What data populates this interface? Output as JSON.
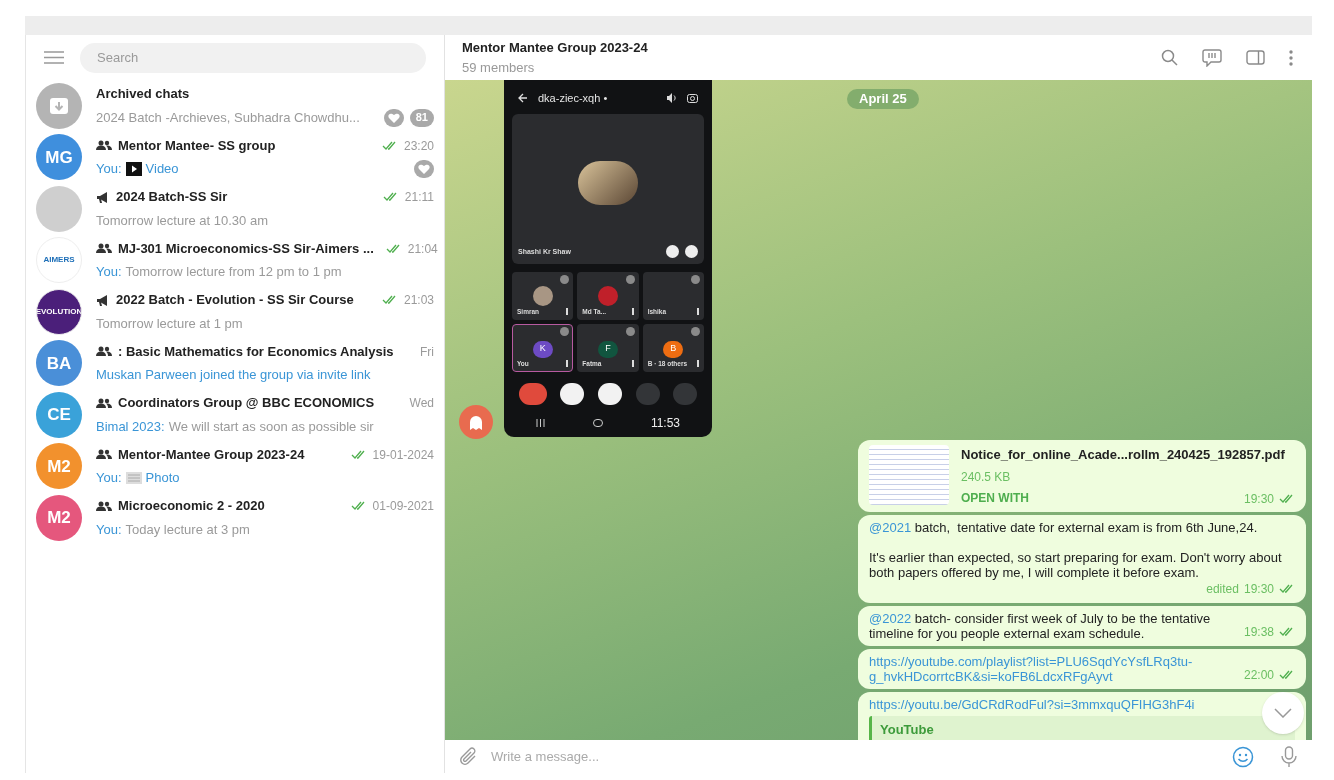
{
  "sidebar": {
    "search": {
      "placeholder": "Search"
    },
    "chats": [
      {
        "kind": "archive",
        "title": "Archived chats",
        "avatar": {
          "kind": "archive",
          "color": "#b4b4b4"
        },
        "preview": {
          "kind": "message",
          "text": "2024 Batch -Archieves, Subhadra Chowdhu..."
        },
        "heart": true,
        "unread": "81",
        "read": false
      },
      {
        "kind": "group",
        "title": "Mentor Mantee- SS group",
        "avatar": {
          "kind": "initials",
          "text": "MG",
          "color": "#3f8fdd"
        },
        "time": "23:20",
        "read": true,
        "preview": {
          "sender": "You:",
          "kind": "video",
          "text": "Video"
        },
        "heart": true
      },
      {
        "kind": "channel",
        "title": "2024 Batch-SS Sir",
        "avatar": {
          "kind": "image",
          "color": "#cfcfcf"
        },
        "time": "21:11",
        "read": true,
        "preview": {
          "kind": "message",
          "text": "Tomorrow lecture at 10.30 am"
        },
        "heart": false
      },
      {
        "kind": "group",
        "title": "MJ-301 Microeconomics-SS Sir-Aimers ...",
        "avatar": {
          "kind": "logo",
          "text": "AIMERS",
          "color": "#ffffff"
        },
        "time": "21:04",
        "read": true,
        "preview": {
          "sender": "You:",
          "kind": "message",
          "text": "Tomorrow lecture from 12 pm to 1 pm"
        },
        "heart": false
      },
      {
        "kind": "channel",
        "title": "2022 Batch - Evolution - SS Sir Course",
        "avatar": {
          "kind": "logo",
          "text": "EVOLUTION",
          "color": "#4b1f7a"
        },
        "time": "21:03",
        "read": true,
        "preview": {
          "kind": "message",
          "text": "Tomorrow lecture at 1 pm"
        },
        "heart": false
      },
      {
        "kind": "group",
        "title": ": Basic Mathematics for Economics Analysis",
        "avatar": {
          "kind": "initials",
          "text": "BA",
          "color": "#4a8fd8"
        },
        "time": "Fri",
        "read": false,
        "preview": {
          "kind": "service",
          "text": "Muskan Parween joined the group via invite link"
        },
        "heart": false
      },
      {
        "kind": "group",
        "title": "Coordinators Group @ BBC ECONOMICS",
        "avatar": {
          "kind": "initials",
          "text": "CE",
          "color": "#3aa2d9"
        },
        "time": "Wed",
        "read": false,
        "preview": {
          "sender": "Bimal 2023:",
          "kind": "message",
          "text": "We will start as soon as possible sir"
        },
        "heart": false
      },
      {
        "kind": "group",
        "title": "Mentor-Mantee Group 2023-24",
        "avatar": {
          "kind": "initials",
          "text": "M2",
          "color": "#f2912d"
        },
        "time": "19-01-2024",
        "read": true,
        "preview": {
          "sender": "You:",
          "kind": "photo",
          "text": "Photo"
        },
        "heart": false
      },
      {
        "kind": "group",
        "title": "Microeconomic 2 - 2020",
        "avatar": {
          "kind": "initials",
          "text": "M2",
          "color": "#e5577d"
        },
        "time": "01-09-2021",
        "read": true,
        "preview": {
          "sender": "You:",
          "kind": "message",
          "text": "Today lecture at 3 pm"
        },
        "heart": false
      }
    ]
  },
  "chat": {
    "title": "Mentor Mantee Group 2023-24",
    "subtitle": "59 members",
    "date": "April 25",
    "screenshot": {
      "call_code": "dka-ziec-xqh •",
      "speaker": "Shashi Kr Shaw",
      "clock": "11:53",
      "tiles": [
        {
          "name": "Simran",
          "avatar": {
            "kind": "photo",
            "color": "#a89684"
          },
          "highlighted": false
        },
        {
          "name": "Md Ta...",
          "avatar": {
            "kind": "photo",
            "color": "#c0202a"
          },
          "highlighted": false
        },
        {
          "name": "Ishika",
          "avatar": {
            "kind": "none"
          },
          "highlighted": false
        },
        {
          "name": "You",
          "avatar": {
            "kind": "initial",
            "text": "K",
            "color": "#6d4bc4"
          },
          "highlighted": true
        },
        {
          "name": "Fatma",
          "avatar": {
            "kind": "initial",
            "text": "F",
            "color": "#11553f"
          },
          "highlighted": false
        },
        {
          "name": "B · 18 others",
          "avatar": {
            "kind": "initial",
            "text": "B",
            "color": "#ee6d12"
          },
          "highlighted": false
        }
      ]
    },
    "messages": [
      {
        "kind": "file",
        "thumbnail": true,
        "filename": "Notice_for_online_Acade...rollm_240425_192857.pdf",
        "size": "240.5 KB",
        "action": "OPEN WITH",
        "time": "19:30",
        "read": true
      },
      {
        "kind": "text",
        "mention": "@2021",
        "paragraphs": [
          " batch,  tentative date for external exam is from 6th June,24.",
          "It's earlier than expected, so start preparing for exam. Don't worry about both papers offered by me, I will complete it before exam."
        ],
        "edited": "edited",
        "time": "19:30",
        "read": true
      },
      {
        "kind": "text",
        "mention": "@2022",
        "paragraphs": [
          " batch- consider first week of July to be the tentative timeline for you people external exam schedule."
        ],
        "time": "19:38",
        "read": true
      },
      {
        "kind": "link",
        "url": "https://youtube.com/playlist?list=PLU6SqdYcYsfLRq3tu-g_hvkHDcorrtcBK&si=koFB6LdcxRFgAyvt",
        "time": "22:00",
        "read": true
      },
      {
        "kind": "link",
        "url": "https://youtu.be/GdCRdRodFul?si=3mmxquQFIHG3hF4i",
        "preview_site": "YouTube"
      }
    ],
    "composer": {
      "placeholder": "Write a message..."
    }
  }
}
